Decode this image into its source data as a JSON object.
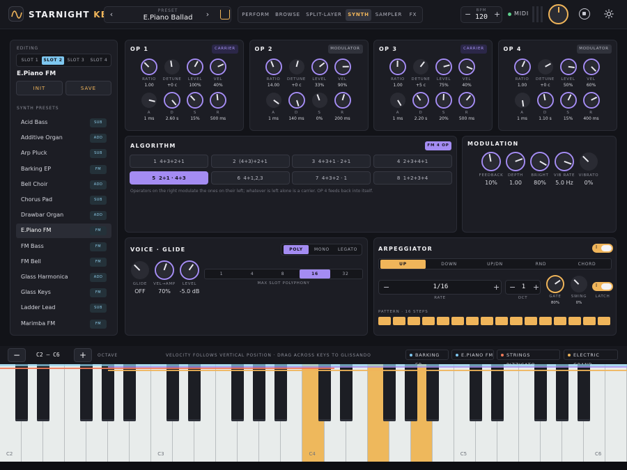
{
  "app": {
    "name_main": "STARNIGHT",
    "name_accent": "KEYS"
  },
  "preset": {
    "label": "PRESET",
    "name": "E.Piano Ballad",
    "prev": "‹",
    "next": "›"
  },
  "tabs": [
    "PERFORM",
    "BROWSE",
    "SPLIT-LAYER",
    "SYNTH",
    "SAMPLER",
    "FX"
  ],
  "active_tab": "SYNTH",
  "bpm": {
    "label": "BPM",
    "value": "120",
    "minus": "−",
    "plus": "+"
  },
  "midi": {
    "label": "MIDI",
    "status_color": "#5fd18d"
  },
  "colors": {
    "accent": "#f0b55a",
    "purple": "#a48cf2",
    "blue": "#7ec7f0",
    "bg": "#121318",
    "panel": "#1c1d24"
  },
  "sidebar": {
    "editing_label": "EDITING",
    "slots": [
      "SLOT 1",
      "SLOT 2",
      "SLOT 3",
      "SLOT 4"
    ],
    "active_slot": "SLOT 2",
    "current_name": "E.Piano FM",
    "init_label": "INIT",
    "save_label": "SAVE",
    "presets_label": "SYNTH PRESETS",
    "presets": [
      {
        "name": "Acid Bass",
        "badge": "SUB"
      },
      {
        "name": "Additive Organ",
        "badge": "ADD"
      },
      {
        "name": "Arp Pluck",
        "badge": "SUB"
      },
      {
        "name": "Barking EP",
        "badge": "FM"
      },
      {
        "name": "Bell Choir",
        "badge": "ADD"
      },
      {
        "name": "Chorus Pad",
        "badge": "SUB"
      },
      {
        "name": "Drawbar Organ",
        "badge": "ADD"
      },
      {
        "name": "E.Piano FM",
        "badge": "FM",
        "selected": true
      },
      {
        "name": "FM Bass",
        "badge": "FM"
      },
      {
        "name": "FM Bell",
        "badge": "FM"
      },
      {
        "name": "Glass Harmonica",
        "badge": "ADD"
      },
      {
        "name": "Glass Keys",
        "badge": "FM"
      },
      {
        "name": "Ladder Lead",
        "badge": "SUB"
      },
      {
        "name": "Marimba FM",
        "badge": "FM"
      }
    ]
  },
  "operators": [
    {
      "title": "OP 1",
      "role": "CARRIER",
      "ratio": "1.00",
      "detune": "+0 c",
      "level": "100%",
      "vel": "40%",
      "a": "1 ms",
      "d": "2.60 s",
      "s": "15%",
      "r": "500 ms"
    },
    {
      "title": "OP 2",
      "role": "MODULATOR",
      "ratio": "14.00",
      "detune": "+0 c",
      "level": "33%",
      "vel": "90%",
      "a": "1 ms",
      "d": "140 ms",
      "s": "0%",
      "r": "200 ms"
    },
    {
      "title": "OP 3",
      "role": "CARRIER",
      "ratio": "1.00",
      "detune": "+5 c",
      "level": "75%",
      "vel": "40%",
      "a": "1 ms",
      "d": "2.20 s",
      "s": "20%",
      "r": "500 ms"
    },
    {
      "title": "OP 4",
      "role": "MODULATOR",
      "ratio": "1.00",
      "detune": "+0 c",
      "level": "50%",
      "vel": "60%",
      "a": "1 ms",
      "d": "1.10 s",
      "s": "15%",
      "r": "400 ms"
    }
  ],
  "param_labels": {
    "ratio": "RATIO",
    "detune": "DETUNE",
    "level": "LEVEL",
    "vel": "VEL",
    "a": "A",
    "d": "D",
    "s": "S",
    "r": "R"
  },
  "algorithm": {
    "title": "ALGORITHM",
    "badge": "FM 4 OP",
    "options": [
      {
        "num": "1",
        "formula": "4+3+2+1"
      },
      {
        "num": "2",
        "formula": "(4+3)+2+1"
      },
      {
        "num": "3",
        "formula": "4+3+1 · 2+1"
      },
      {
        "num": "4",
        "formula": "2+3+4+1"
      },
      {
        "num": "5",
        "formula": "2+1 · 4+3"
      },
      {
        "num": "6",
        "formula": "4+1,2,3"
      },
      {
        "num": "7",
        "formula": "4+3+2 · 1"
      },
      {
        "num": "8",
        "formula": "1+2+3+4"
      }
    ],
    "selected": "5",
    "help": "Operators on the right modulate the ones on their left; whatever is left alone is a carrier. OP 4 feeds back into itself."
  },
  "modulation": {
    "title": "MODULATION",
    "knobs": [
      {
        "label": "FEEDBACK",
        "value": "10%"
      },
      {
        "label": "DEPTH",
        "value": "1.00"
      },
      {
        "label": "BRIGHT",
        "value": "80%"
      },
      {
        "label": "VIB RATE",
        "value": "5.0 Hz"
      },
      {
        "label": "VIBRATO",
        "value": "0%"
      }
    ]
  },
  "voice": {
    "title": "VOICE · GLIDE",
    "modes": [
      "POLY",
      "MONO",
      "LEGATO"
    ],
    "active_mode": "POLY",
    "glide_label": "GLIDE",
    "glide_value": "OFF",
    "velamp_label": "VEL→AMP",
    "velamp_value": "70%",
    "level_label": "LEVEL",
    "level_value": "-5.0 dB",
    "polyphony_options": [
      "1",
      "4",
      "8",
      "16",
      "32"
    ],
    "polyphony_selected": "16",
    "polyphony_label": "MAX SLOT POLYPHONY"
  },
  "arpeggiator": {
    "title": "ARPEGGIATOR",
    "enabled": true,
    "toggle_text": "I",
    "modes": [
      "UP",
      "DOWN",
      "UP/DN",
      "RND",
      "CHORD"
    ],
    "active_mode": "UP",
    "rate_value": "1/16",
    "rate_label": "RATE",
    "oct_value": "1",
    "oct_label": "OCT",
    "gate_label": "GATE",
    "gate_value": "80%",
    "swing_label": "SWING",
    "swing_value": "0%",
    "latch_label": "LATCH",
    "latch_toggle_text": "I",
    "pattern_label": "PATTERN · 16 STEPS",
    "steps": 16
  },
  "keyboard_bar": {
    "minus": "−",
    "plus": "+",
    "range": "C2 — C6",
    "octave_label": "OCTAVE",
    "hint": "VELOCITY FOLLOWS VERTICAL POSITION · DRAG ACROSS KEYS TO GLISSANDO",
    "layers": [
      {
        "name": "BARKING EP",
        "color": "#7ec7f0"
      },
      {
        "name": "E.PIANO FM",
        "color": "#7ec7f0"
      },
      {
        "name": "STRINGS PIZZICATO",
        "color": "#f07a5a"
      },
      {
        "name": "ELECTRIC GRAND",
        "color": "#f0b55a"
      }
    ]
  },
  "keyboard": {
    "labels": [
      "C2",
      "C3",
      "C4",
      "C5",
      "C6"
    ],
    "highlighted_keys": [
      "C4",
      "F4",
      "A4"
    ]
  }
}
